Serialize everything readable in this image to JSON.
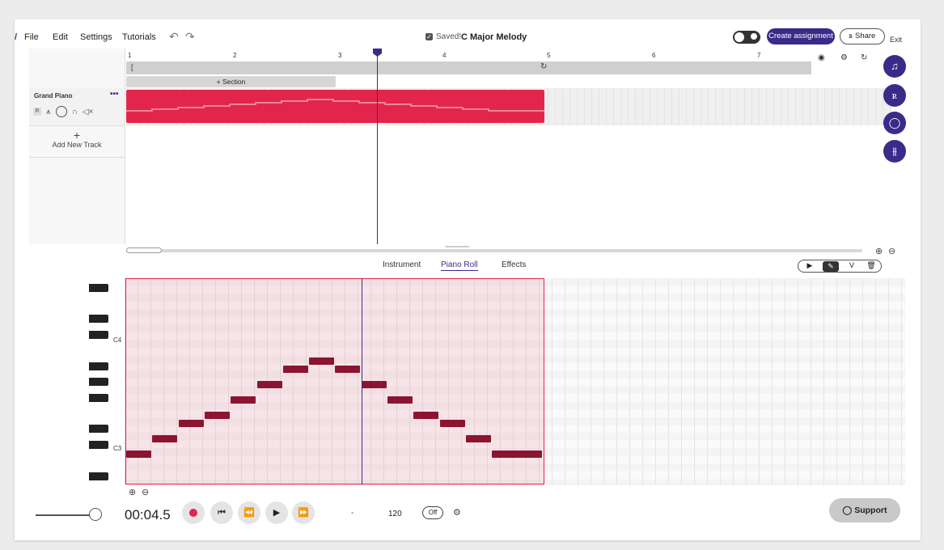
{
  "menu": {
    "file": "File",
    "edit": "Edit",
    "settings": "Settings",
    "tutorials": "Tutorials",
    "undo": "↶",
    "redo": "↷",
    "saved": "Saved!",
    "project_title": "C Major Melody",
    "create_assignment": "Create assignment",
    "share": "Share",
    "exit": "Exit"
  },
  "arrange": {
    "ruler_marks": [
      "1",
      "2",
      "3",
      "4",
      "5",
      "6",
      "7"
    ],
    "section_button": "+ Section",
    "track": {
      "name": "Grand Piano",
      "more": "•••",
      "record": "R"
    },
    "add_track": "Add New Track",
    "zoom_in": "⊕",
    "zoom_out": "⊖"
  },
  "editor": {
    "tabs": [
      "Instrument",
      "Piano Roll",
      "Effects"
    ],
    "active_tab": "Piano Roll",
    "tools": [
      "▶",
      "✎",
      "V",
      "🗑"
    ],
    "key_labels": [
      "C4",
      "C3"
    ],
    "notes_pitch_steps": [
      0,
      2,
      4,
      5,
      7,
      9,
      11,
      12,
      11,
      9,
      7,
      5,
      4,
      2,
      0
    ],
    "zoom_in": "⊕",
    "zoom_out": "⊖"
  },
  "transport": {
    "time": "00:04.5",
    "tempo_placeholder": "-",
    "bpm": "120",
    "metronome": "Off",
    "support": "Support"
  },
  "colors": {
    "accent": "#3b2a8a",
    "clip": "#e2264b",
    "note": "#8b1530"
  }
}
